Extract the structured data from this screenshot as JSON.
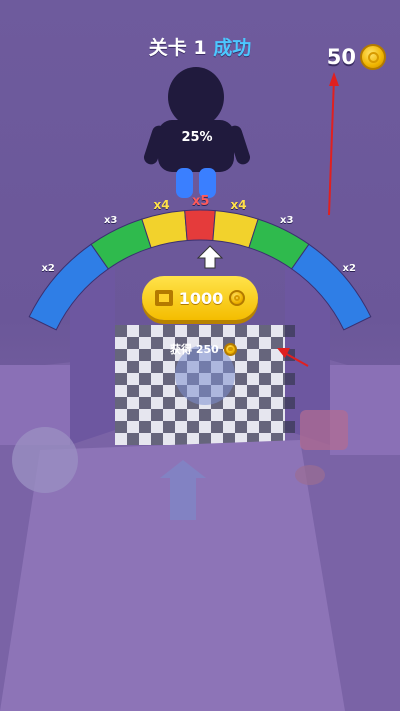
{
  "header": {
    "level_label": "关卡",
    "level_number": "1",
    "status": "成功"
  },
  "coins": {
    "total": "50",
    "icon": "coin-icon"
  },
  "progress": {
    "percent_text": "25%",
    "fill_fraction": 0.25
  },
  "multiplier_bar": {
    "segments": [
      "x2",
      "x3",
      "x4",
      "x5",
      "x4",
      "x3",
      "x2"
    ],
    "colors": [
      "#2f7ee6",
      "#2fba4d",
      "#f2d22c",
      "#e53b3b",
      "#f2d22c",
      "#2fba4d",
      "#2f7ee6"
    ]
  },
  "reward_button": {
    "amount": "1000",
    "icon": "video-icon"
  },
  "earned": {
    "label": "获得 250",
    "icon": "coin-icon"
  },
  "colors": {
    "accent_blue": "#4cc7ff",
    "gold": "#f4bd00",
    "annotation_red": "#e02020"
  }
}
